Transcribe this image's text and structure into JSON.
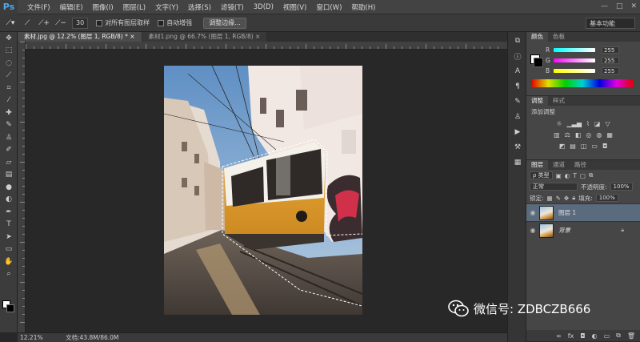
{
  "app": {
    "logo": "Ps"
  },
  "menu": [
    "文件(F)",
    "编辑(E)",
    "图像(I)",
    "图层(L)",
    "文字(Y)",
    "选择(S)",
    "滤镜(T)",
    "3D(D)",
    "视图(V)",
    "窗口(W)",
    "帮助(H)"
  ],
  "window_controls": {
    "minimize": "—",
    "maximize": "□",
    "close": "✕"
  },
  "options": {
    "brush_size": "30",
    "sample_all_layers": "对所有图层取样",
    "auto_enhance": "自动增强",
    "refine_edge": "调整边缘...",
    "workspace": "基本功能"
  },
  "tabs": [
    {
      "label": "素材.jpg @ 12.2% (图层 1, RGB/8) *  ×"
    },
    {
      "label": "素材1.png @ 66.7% (图层 1, RGB/8)  ×"
    }
  ],
  "status": {
    "zoom": "12.21%",
    "doc": "文档:43.8M/86.0M"
  },
  "color_panel": {
    "tabs": [
      "颜色",
      "色板"
    ],
    "rows": [
      {
        "label": "R",
        "value": "255",
        "gradient": "linear-gradient(to right,#00ffff,#ffffff)"
      },
      {
        "label": "G",
        "value": "255",
        "gradient": "linear-gradient(to right,#ff00ff,#ffffff)"
      },
      {
        "label": "B",
        "value": "255",
        "gradient": "linear-gradient(to right,#ffff00,#ffffff)"
      }
    ]
  },
  "adjust_panel": {
    "tabs": [
      "调整",
      "样式"
    ],
    "title": "添加调整"
  },
  "layers_panel": {
    "tabs": [
      "图层",
      "通道",
      "路径"
    ],
    "kind": "ρ 类型",
    "blend_mode": "正常",
    "opacity_label": "不透明度:",
    "opacity": "100%",
    "lock_label": "锁定:",
    "fill_label": "填充:",
    "fill": "100%",
    "layers": [
      {
        "name": "图层 1",
        "selected": true
      },
      {
        "name": "背景",
        "selected": false
      }
    ]
  },
  "watermark": {
    "text": "微信号: ZDBCZB666"
  },
  "colors": {
    "accent": "#e8262b",
    "selected_layer": "#5b6b7e",
    "ps_blue": "#4fa9e8"
  }
}
